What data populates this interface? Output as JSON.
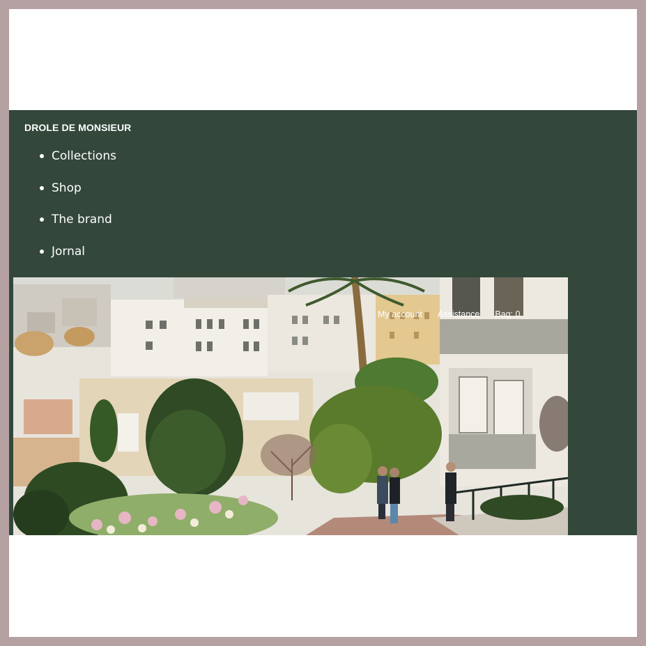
{
  "brand": {
    "name": "DROLE DE MONSIEUR"
  },
  "nav": {
    "items": [
      {
        "label": "Collections"
      },
      {
        "label": "Shop"
      },
      {
        "label": "The brand"
      },
      {
        "label": "Jornal"
      }
    ]
  },
  "utility": {
    "account": "My account",
    "assistance": "Assistance",
    "bag": "Bag: 0"
  },
  "colors": {
    "frame": "#b5a1a1",
    "header_bg": "#33473b",
    "page_bg": "#ffffff",
    "text": "#ffffff"
  }
}
